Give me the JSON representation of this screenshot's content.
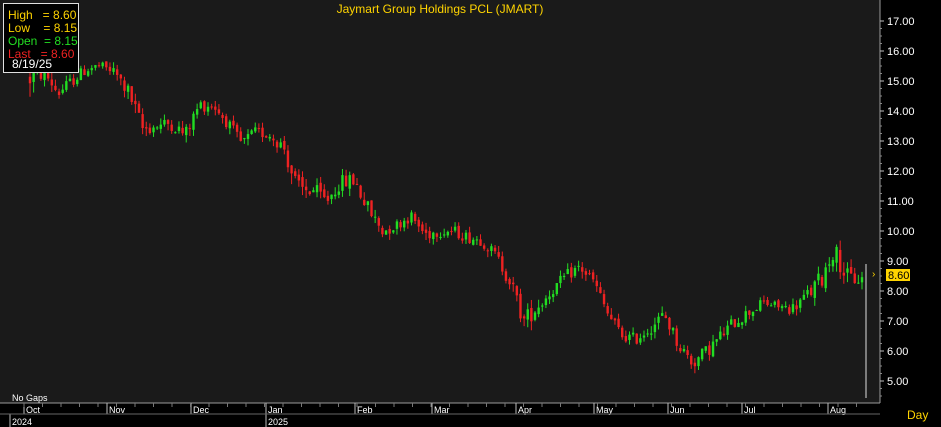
{
  "chart_data": {
    "type": "ohlc",
    "title": "Jaymart Group Holdings PCL (JMART)",
    "info_box": {
      "high": "High   = 8.60",
      "low": "Low    = 8.15",
      "open": "Open  = 8.15",
      "last": "Last   = 8.60",
      "date": "8/19/25"
    },
    "last_value_label": "8.60",
    "last_value": 8.6,
    "x_ticks": [
      "Oct",
      "Nov",
      "Dec",
      "Jan",
      "Feb",
      "Mar",
      "Apr",
      "May",
      "Jun",
      "Jul",
      "Aug"
    ],
    "year_labels": [
      "2024",
      "2025"
    ],
    "y_ticks": [
      "17.00",
      "16.00",
      "15.00",
      "14.00",
      "13.00",
      "12.00",
      "11.00",
      "10.00",
      "9.00",
      "8.00",
      "7.00",
      "6.00",
      "5.00"
    ],
    "ylim": [
      4.6,
      17.4
    ],
    "period_label": "Day",
    "note": "No Gaps",
    "up_color": "#22dd22",
    "down_color": "#ee2222",
    "approx_close_by_month": [
      {
        "month": "Oct",
        "close": 15.0
      },
      {
        "month": "Nov",
        "close": 13.4
      },
      {
        "month": "Dec",
        "close": 13.0
      },
      {
        "month": "Jan",
        "close": 11.2
      },
      {
        "month": "Feb",
        "close": 10.1
      },
      {
        "month": "Mar",
        "close": 9.6
      },
      {
        "month": "Apr",
        "close": 7.0
      },
      {
        "month": "May",
        "close": 7.6
      },
      {
        "month": "Jun",
        "close": 5.7
      },
      {
        "month": "Jul",
        "close": 7.4
      },
      {
        "month": "Aug",
        "close": 8.6
      }
    ],
    "anchors": [
      [
        15.1,
        0.9
      ],
      [
        15.3,
        0.5
      ],
      [
        14.6,
        0.5
      ],
      [
        15.0,
        0.4
      ],
      [
        15.4,
        0.4
      ],
      [
        15.5,
        0.3
      ],
      [
        15.3,
        0.4
      ],
      [
        14.6,
        0.6
      ],
      [
        13.4,
        0.6
      ],
      [
        13.5,
        0.4
      ],
      [
        13.6,
        0.5
      ],
      [
        13.2,
        0.5
      ],
      [
        14.2,
        0.5
      ],
      [
        14.2,
        0.4
      ],
      [
        13.6,
        0.4
      ],
      [
        12.9,
        0.5
      ],
      [
        13.3,
        0.4
      ],
      [
        13.2,
        0.4
      ],
      [
        12.8,
        0.5
      ],
      [
        11.3,
        0.9
      ],
      [
        11.4,
        0.6
      ],
      [
        11.0,
        0.5
      ],
      [
        11.6,
        0.5
      ],
      [
        11.7,
        0.6
      ],
      [
        10.7,
        0.6
      ],
      [
        10.0,
        0.5
      ],
      [
        10.2,
        0.4
      ],
      [
        10.5,
        0.4
      ],
      [
        9.9,
        0.5
      ],
      [
        10.0,
        0.4
      ],
      [
        10.0,
        0.4
      ],
      [
        9.8,
        0.4
      ],
      [
        9.7,
        0.4
      ],
      [
        9.2,
        0.4
      ],
      [
        8.4,
        0.6
      ],
      [
        7.0,
        0.6
      ],
      [
        7.5,
        0.6
      ],
      [
        8.0,
        0.4
      ],
      [
        8.5,
        0.4
      ],
      [
        8.8,
        0.5
      ],
      [
        8.3,
        0.4
      ],
      [
        7.2,
        0.5
      ],
      [
        6.5,
        0.4
      ],
      [
        6.4,
        0.4
      ],
      [
        6.8,
        0.5
      ],
      [
        7.2,
        0.5
      ],
      [
        6.2,
        0.5
      ],
      [
        5.6,
        0.5
      ],
      [
        6.0,
        0.5
      ],
      [
        6.5,
        0.5
      ],
      [
        7.0,
        0.5
      ],
      [
        7.3,
        0.4
      ],
      [
        7.6,
        0.4
      ],
      [
        7.5,
        0.3
      ],
      [
        7.4,
        0.4
      ],
      [
        7.8,
        0.5
      ],
      [
        8.3,
        0.8
      ],
      [
        9.4,
        0.7
      ],
      [
        8.4,
        0.7
      ],
      [
        8.4,
        0.5
      ]
    ]
  }
}
